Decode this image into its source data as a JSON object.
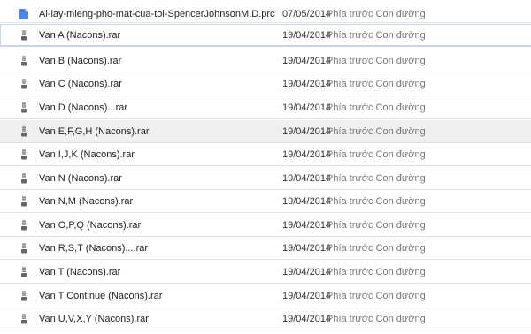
{
  "files": [
    {
      "name": "Ai-lay-mieng-pho-mat-cua-toi-SpencerJohnsonM.D.prc",
      "date": "07/05/2014",
      "owner": "Phía trước Con đường",
      "icon": "document-icon",
      "icon_color": "#4a86e8"
    },
    {
      "name": "Van A (Nacons).rar",
      "date": "19/04/2014",
      "owner": "Phía trước Con đường",
      "icon": "archive-icon"
    },
    {
      "name": "Van B (Nacons).rar",
      "date": "19/04/2014",
      "owner": "Phía trước Con đường",
      "icon": "archive-icon"
    },
    {
      "name": "Van C (Nacons).rar",
      "date": "19/04/2014",
      "owner": "Phía trước Con đường",
      "icon": "archive-icon"
    },
    {
      "name": "Van D (Nacons)...rar",
      "date": "19/04/2014",
      "owner": "Phía trước Con đường",
      "icon": "archive-icon"
    },
    {
      "name": "Van E,F,G,H (Nacons).rar",
      "date": "19/04/2014",
      "owner": "Phía trước Con đường",
      "icon": "archive-icon"
    },
    {
      "name": "Van I,J,K (Nacons).rar",
      "date": "19/04/2014",
      "owner": "Phía trước Con đường",
      "icon": "archive-icon"
    },
    {
      "name": "Van N (Nacons).rar",
      "date": "19/04/2014",
      "owner": "Phía trước Con đường",
      "icon": "archive-icon"
    },
    {
      "name": "Van N,M (Nacons).rar",
      "date": "19/04/2014",
      "owner": "Phía trước Con đường",
      "icon": "archive-icon"
    },
    {
      "name": "Van O,P,Q (Nacons).rar",
      "date": "19/04/2014",
      "owner": "Phía trước Con đường",
      "icon": "archive-icon"
    },
    {
      "name": "Van R,S,T (Nacons)....rar",
      "date": "19/04/2014",
      "owner": "Phía trước Con đường",
      "icon": "archive-icon"
    },
    {
      "name": "Van T (Nacons).rar",
      "date": "19/04/2014",
      "owner": "Phía trước Con đường",
      "icon": "archive-icon"
    },
    {
      "name": "Van T Continue (Nacons).rar",
      "date": "19/04/2014",
      "owner": "Phía trước Con đường",
      "icon": "archive-icon"
    },
    {
      "name": "Van U,V,X,Y (Nacons).rar",
      "date": "19/04/2014",
      "owner": "Phía trước Con đường",
      "icon": "archive-icon"
    }
  ]
}
